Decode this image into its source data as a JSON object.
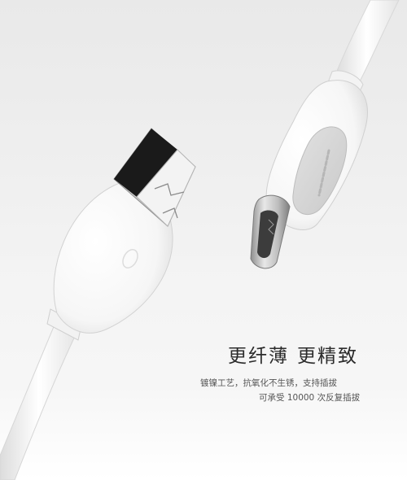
{
  "headline": {
    "part1": "更纤薄",
    "part2": "更精致"
  },
  "description": {
    "line1": "镀镍工艺，抗氧化不生锈，支持插拔",
    "line2": "可承受 10000 次反复插拔"
  },
  "colors": {
    "background": "#eeeeee",
    "cable_white": "#fbfbfb",
    "connector_metal": "#c9c9c9",
    "headline_text": "#2b2b2b",
    "body_text": "#555555"
  }
}
